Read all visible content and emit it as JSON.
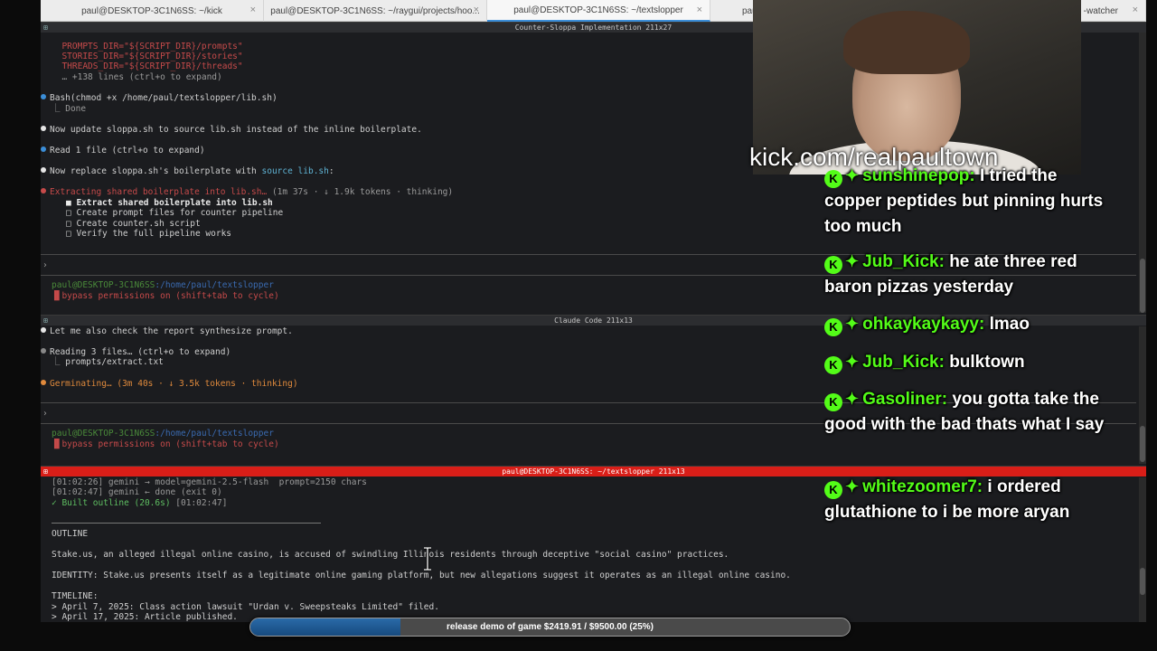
{
  "tabs": [
    {
      "label": "paul@DESKTOP-3C1N6SS: ~/kick",
      "close": "×"
    },
    {
      "label": "paul@DESKTOP-3C1N6SS: ~/raygui/projects/hoo...",
      "close": "×"
    },
    {
      "label": "paul@DESKTOP-3C1N6SS: ~/textslopper",
      "close": "×"
    },
    {
      "label": "paul@DE",
      "close": "×"
    },
    {
      "label": "-watcher",
      "close": "×"
    }
  ],
  "pane1": {
    "title": "Counter-Sloppa Implementation 211x27",
    "lines": [
      "  PROMPTS_DIR=\"${SCRIPT_DIR}/prompts\"",
      "  STORIES_DIR=\"${SCRIPT_DIR}/stories\"",
      "  THREADS_DIR=\"${SCRIPT_DIR}/threads\"",
      "  … +138 lines (ctrl+o to expand)"
    ],
    "bash_cmd": "Bash(chmod +x /home/paul/textslopper/lib.sh)",
    "bash_done": "Done",
    "msg1": "Now update sloppa.sh to source lib.sh instead of the inline boilerplate.",
    "read": "Read 1 file (ctrl+o to expand)",
    "msg2_a": "Now replace sloppa.sh's boilerplate with ",
    "msg2_b": "source lib.sh",
    "msg2_c": ":",
    "status_a": "Extracting shared boilerplate into lib.sh…",
    "status_b": " (1m 37s · ↓ 1.9k tokens · thinking)",
    "todos": [
      "■ Extract shared boilerplate into lib.sh",
      "□ Create prompt files for counter pipeline",
      "□ Create counter.sh script",
      "□ Verify the full pipeline works"
    ],
    "prompt": "›",
    "user": "paul@DESKTOP-3C1N6SS",
    "path": ":/home/paul/textslopper",
    "bypass": "bypass permissions on (shift+tab to cycle)"
  },
  "pane2": {
    "title": "Claude Code 211x13",
    "msg": "Let me also check the report synthesize prompt.",
    "reading": "Reading 3 files… (ctrl+o to expand)",
    "file": "prompts/extract.txt",
    "status": "Germinating… (3m 40s · ↓ 3.5k tokens · thinking)",
    "prompt": "›",
    "user": "paul@DESKTOP-3C1N6SS",
    "path": ":/home/paul/textslopper",
    "bypass": "bypass permissions on (shift+tab to cycle)"
  },
  "pane3": {
    "title": "paul@DESKTOP-3C1N6SS: ~/textslopper 211x13",
    "log1": "[01:02:26] gemini → model=gemini-2.5-flash  prompt=2150 chars",
    "log2": "[01:02:47] gemini ← done (exit 0)",
    "built": "✓ Built outline (20.6s)",
    "built_ts": "[01:02:47]",
    "outline": "OUTLINE",
    "summary": "Stake.us, an alleged illegal online casino, is accused of swindling Illinois residents through deceptive \"social casino\" practices.",
    "identity": "IDENTITY: Stake.us presents itself as a legitimate online gaming platform, but new allegations suggest it operates as an illegal online casino.",
    "timeline": "TIMELINE:",
    "t1": "> April 7, 2025: Class action lawsuit \"Urdan v. Sweepsteaks Limited\" filed.",
    "t2": "> April 17, 2025: Article published."
  },
  "overlay": {
    "url": "kick.com/realpaultown"
  },
  "chat": [
    {
      "user": "sunshinepop:",
      "text": "I tried the copper peptides but pinning hurts too much"
    },
    {
      "user": "Jub_Kick:",
      "text": "he ate three red baron pizzas yesterday"
    },
    {
      "user": "ohkaykaykayy:",
      "text": "lmao"
    },
    {
      "user": "Jub_Kick:",
      "text": "bulktown"
    },
    {
      "user": "Gasoliner:",
      "text": "you gotta take the good with the bad thats what I say"
    },
    {
      "user": "whitezoomer7:",
      "text": "i ordered glutathione to i be more aryan"
    }
  ],
  "goal": {
    "label": "release demo of game $2419.91 / $9500.00 (25%)",
    "progress": 0.25
  },
  "colors": {
    "kick_green": "#53fc18",
    "pane_alert": "#d91e18"
  },
  "icons": {
    "chat_badge": "kick-badge-icon",
    "chat_diamond": "diamond-icon"
  }
}
